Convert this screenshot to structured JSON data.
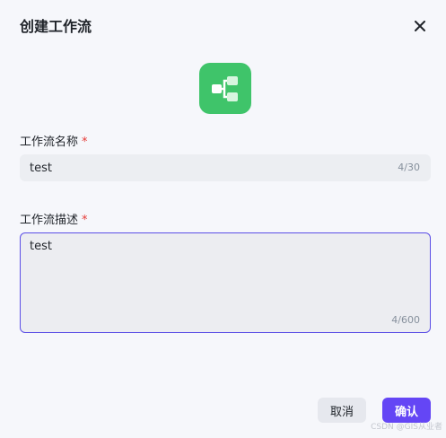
{
  "dialog": {
    "title": "创建工作流",
    "close_icon": "close-icon"
  },
  "app_icon": {
    "icon": "workflow-icon",
    "color": "#3fc46a"
  },
  "name_field": {
    "label": "工作流名称",
    "required_mark": "*",
    "value": "test",
    "counter": "4/30"
  },
  "description_field": {
    "label": "工作流描述",
    "required_mark": "*",
    "value": "test",
    "counter": "4/600"
  },
  "actions": {
    "cancel_label": "取消",
    "confirm_label": "确认"
  },
  "watermark": "CSDN @GIS从业者",
  "colors": {
    "accent": "#6446f5",
    "focus_border": "#5b4ee6",
    "required": "#e53935"
  }
}
